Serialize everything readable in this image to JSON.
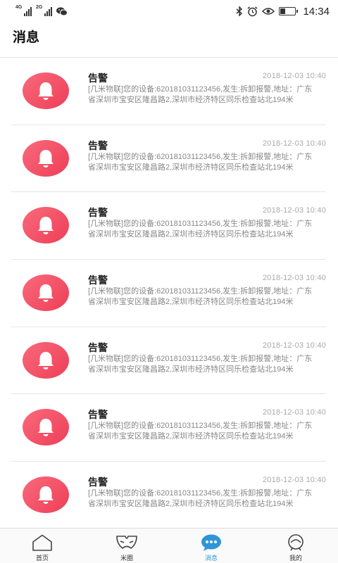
{
  "status_bar": {
    "sim1": "4G",
    "sim2": "2G",
    "time": "14:34",
    "battery_level": 0.35
  },
  "header": {
    "title": "消息"
  },
  "messages": [
    {
      "title": "告警",
      "time": "2018-12-03 10:40",
      "body": "[几米物联]您的设备:620181031123456,发生:拆卸报警,地址：广东省深圳市宝安区隆昌路2,深圳市经济特区同乐检查站北194米"
    },
    {
      "title": "告警",
      "time": "2018-12-03 10:40",
      "body": "[几米物联]您的设备:620181031123456,发生:拆卸报警,地址：广东省深圳市宝安区隆昌路2,深圳市经济特区同乐检查站北194米"
    },
    {
      "title": "告警",
      "time": "2018-12-03 10:40",
      "body": "[几米物联]您的设备:620181031123456,发生:拆卸报警,地址：广东省深圳市宝安区隆昌路2,深圳市经济特区同乐检查站北194米"
    },
    {
      "title": "告警",
      "time": "2018-12-03 10:40",
      "body": "[几米物联]您的设备:620181031123456,发生:拆卸报警,地址：广东省深圳市宝安区隆昌路2,深圳市经济特区同乐检查站北194米"
    },
    {
      "title": "告警",
      "time": "2018-12-03 10:40",
      "body": "[几米物联]您的设备:620181031123456,发生:拆卸报警,地址：广东省深圳市宝安区隆昌路2,深圳市经济特区同乐检查站北194米"
    },
    {
      "title": "告警",
      "time": "2018-12-03 10:40",
      "body": "[几米物联]您的设备:620181031123456,发生:拆卸报警,地址：广东省深圳市宝安区隆昌路2,深圳市经济特区同乐检查站北194米"
    },
    {
      "title": "告警",
      "time": "2018-12-03 10:40",
      "body": "[几米物联]您的设备:620181031123456,发生:拆卸报警,地址：广东省深圳市宝安区隆昌路2,深圳市经济特区同乐检查站北194米"
    }
  ],
  "bottom_nav": {
    "items": [
      {
        "label": "首页",
        "icon": "home-icon"
      },
      {
        "label": "米圈",
        "icon": "mask-icon"
      },
      {
        "label": "消息",
        "icon": "chat-bubble-icon",
        "active": true
      },
      {
        "label": "我的",
        "icon": "profile-icon"
      }
    ]
  },
  "colors": {
    "accent": "#2f95d8",
    "alarm": "#f0475f"
  }
}
